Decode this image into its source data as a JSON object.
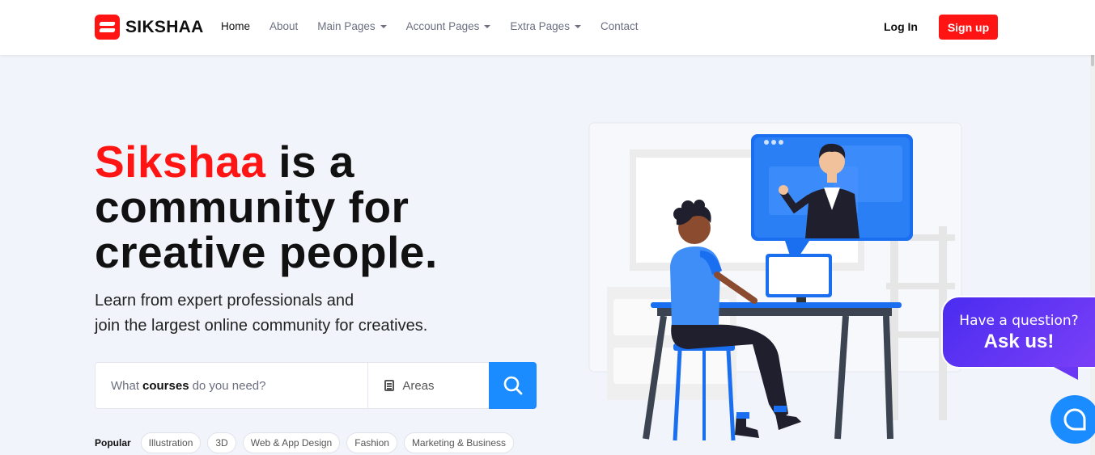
{
  "brand": {
    "name": "SIKSHAA"
  },
  "nav": {
    "items": [
      {
        "label": "Home",
        "active": true,
        "dropdown": false
      },
      {
        "label": "About",
        "active": false,
        "dropdown": false
      },
      {
        "label": "Main Pages",
        "active": false,
        "dropdown": true
      },
      {
        "label": "Account Pages",
        "active": false,
        "dropdown": true
      },
      {
        "label": "Extra Pages",
        "active": false,
        "dropdown": true
      },
      {
        "label": "Contact",
        "active": false,
        "dropdown": false
      }
    ],
    "login_label": "Log In",
    "signup_label": "Sign up"
  },
  "hero": {
    "title_accent": "Sikshaa",
    "title_rest_1": " is a",
    "title_line_2": "community for",
    "title_line_3": "creative people.",
    "subtitle_line_1": "Learn from expert professionals and",
    "subtitle_line_2": "join the largest online community for creatives."
  },
  "search": {
    "placeholder_pre": "What",
    "placeholder_bold": "courses",
    "placeholder_post": "do you need?",
    "areas_label": "Areas"
  },
  "popular": {
    "label": "Popular",
    "tags": [
      "Illustration",
      "3D",
      "Web & App Design",
      "Fashion",
      "Marketing & Business"
    ]
  },
  "chat": {
    "question": "Have a question?",
    "cta": "Ask us!"
  },
  "colors": {
    "brand_red": "#ff1414",
    "accent_blue": "#1a8cff",
    "chat_purple": "#6236f5"
  }
}
